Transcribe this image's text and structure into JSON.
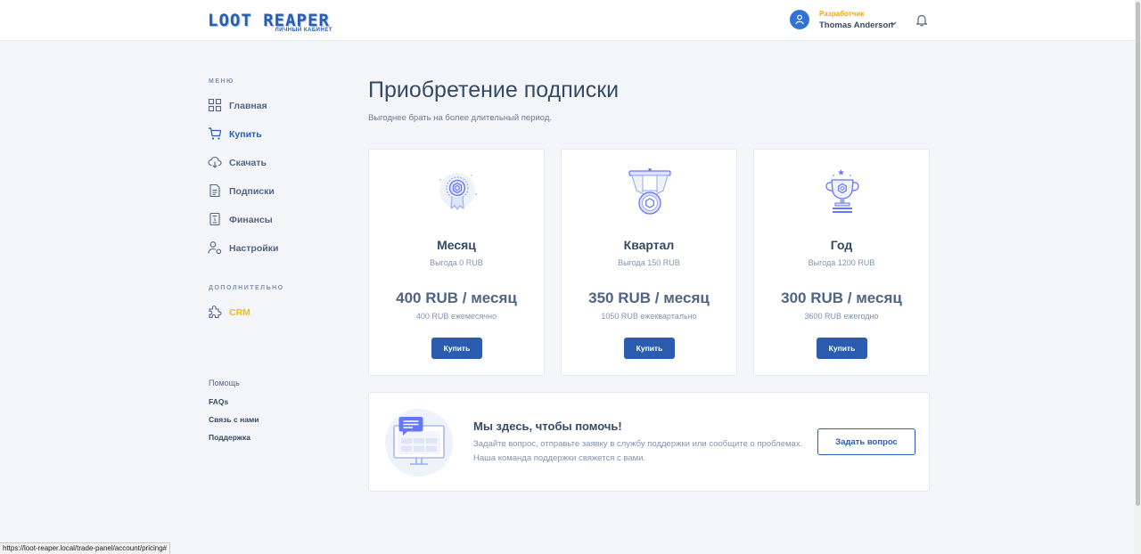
{
  "header": {
    "logo_main": "LOOT REAPER",
    "logo_sub": "ЛИЧНЫЙ КАБИНЕТ",
    "user_role": "Разработчик",
    "user_name": "Thomas Anderson"
  },
  "sidebar": {
    "menu_heading": "МЕНЮ",
    "items": [
      {
        "label": "Главная",
        "icon": "grid-icon"
      },
      {
        "label": "Купить",
        "icon": "cart-icon"
      },
      {
        "label": "Скачать",
        "icon": "cloud-download-icon"
      },
      {
        "label": "Подписки",
        "icon": "document-icon"
      },
      {
        "label": "Финансы",
        "icon": "invoice-icon"
      },
      {
        "label": "Настройки",
        "icon": "user-settings-icon"
      }
    ],
    "extra_heading": "ДОПОЛНИТЕЛЬНО",
    "crm_label": "CRM",
    "help_heading": "Помощь",
    "help_links": [
      "FAQs",
      "Связь с нами",
      "Поддержка"
    ]
  },
  "main": {
    "title": "Приобретение подписки",
    "subtitle": "Выгоднее брать на более длительный период.",
    "plans": [
      {
        "name": "Месяц",
        "benefit": "Выгода 0 RUB",
        "price": "400 RUB / месяц",
        "billing": "400 RUB ежемесячно",
        "button": "Купить",
        "icon": "badge-icon"
      },
      {
        "name": "Квартал",
        "benefit": "Выгода 150 RUB",
        "price": "350 RUB / месяц",
        "billing": "1050 RUB ежеквартально",
        "button": "Купить",
        "icon": "medal-icon"
      },
      {
        "name": "Год",
        "benefit": "Выгода 1200 RUB",
        "price": "300 RUB / месяц",
        "billing": "3600 RUB ежегодно",
        "button": "Купить",
        "icon": "trophy-icon"
      }
    ],
    "help": {
      "title": "Мы здесь, чтобы помочь!",
      "text": "Задайте вопрос, отправьте заявку в службу поддержки или сообщите о проблемах. Наша команда поддержки свяжется с вами.",
      "button": "Задать вопрос"
    }
  },
  "status_url": "https://loot-reaper.local/trade-panel/account/pricing#",
  "colors": {
    "primary": "#2a5db0",
    "accent": "#f4bd0e",
    "text": "#364a63",
    "muted": "#8094ae",
    "background": "#f4f5f9"
  }
}
